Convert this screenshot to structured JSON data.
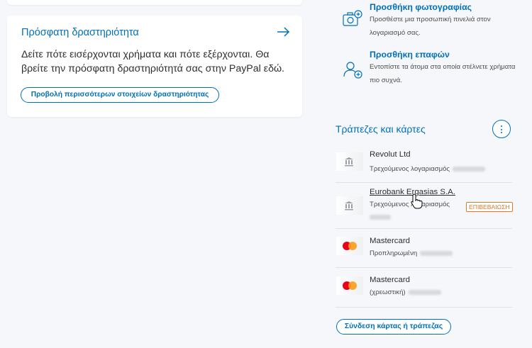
{
  "activity": {
    "title": "Πρόσφατη δραστηριότητα",
    "description": "Δείτε πότε εισέρχονται χρήματα και πότε εξέρχονται. Θα βρείτε την πρόσφατη δραστηριότητά σας στην PayPal εδώ.",
    "button_label": "Προβολή περισσότερων στοιχείων δραστηριότητας"
  },
  "side": {
    "photo": {
      "title": "Προσθήκη φωτογραφίας",
      "desc": "Προσθέστε μια προσωπική πινελιά στον λογαριασμό σας.",
      "icon": "camera-plus-icon"
    },
    "contacts": {
      "title": "Προσθήκη επαφών",
      "desc": "Εντοπίστε τα άτομα στα οποία στέλνετε χρήματα πιο συχνά.",
      "icon": "person-plus-icon"
    }
  },
  "banks": {
    "title": "Τράπεζες και κάρτες",
    "items": [
      {
        "name": "Revolut Ltd",
        "type": "Τρεχούμενος λογαριασμός",
        "icon": "bank-icon"
      },
      {
        "name": "Eurobank Ergasias S.A.",
        "type": "Τρεχούμενος λογαριασμός",
        "badge": "ΕΠΙΒΕΒΑΙΩΣΗ",
        "icon": "bank-icon"
      },
      {
        "name": "Mastercard",
        "type": "Προπληρωμένη",
        "icon": "mastercard-icon"
      },
      {
        "name": "Mastercard",
        "type": "(χρεωστική)",
        "icon": "mastercard-icon"
      }
    ],
    "link_button": "Σύνδεση κάρτας ή τράπεζας"
  },
  "colors": {
    "accent": "#0070ba",
    "warning": "#e87722",
    "background": "#f5f7fa"
  }
}
